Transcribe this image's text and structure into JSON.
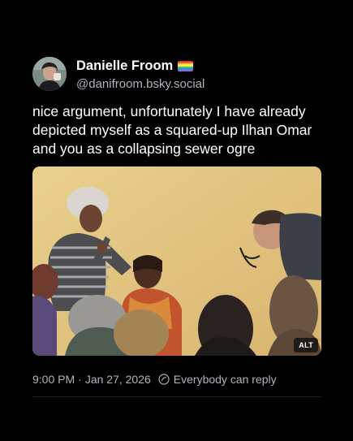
{
  "post": {
    "author": {
      "display_name": "Danielle Froom",
      "handle": "@danifroom.bsky.social",
      "name_badge": "rainbow-flag-emoji"
    },
    "text": "nice argument, unfortunately I have already depicted myself as a squared-up Ilhan Omar and you as a collapsing sewer ogre",
    "media": {
      "alt_badge": "ALT"
    },
    "timestamp": "9:00 PM",
    "date": "Jan 27, 2026",
    "separator": "·",
    "reply_setting": "Everybody can reply",
    "reply_icon": "globe-icon"
  },
  "colors": {
    "background": "#000000",
    "text_primary": "#ffffff",
    "text_secondary": "#aeb4bd",
    "divider": "#1b1d21"
  }
}
